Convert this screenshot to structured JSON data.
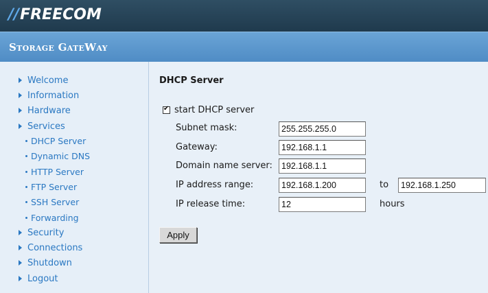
{
  "header": {
    "logo_text": "FREECOM",
    "logo_bars": "//",
    "product_name": "Storage GateWay",
    "colors": {
      "topbar": "#1f3a4d",
      "subbar": "#5a95cc",
      "logo_accent": "#5fa8e8",
      "link": "#2a78c2"
    }
  },
  "sidebar": {
    "items": [
      {
        "label": "Welcome"
      },
      {
        "label": "Information"
      },
      {
        "label": "Hardware"
      },
      {
        "label": "Services"
      }
    ],
    "services_sub": [
      {
        "label": "DHCP Server"
      },
      {
        "label": "Dynamic DNS"
      },
      {
        "label": "HTTP Server"
      },
      {
        "label": "FTP Server"
      },
      {
        "label": "SSH Server"
      },
      {
        "label": "Forwarding"
      }
    ],
    "items_after": [
      {
        "label": "Security"
      },
      {
        "label": "Connections"
      },
      {
        "label": "Shutdown"
      },
      {
        "label": "Logout"
      }
    ]
  },
  "main": {
    "title": "DHCP Server",
    "start_dhcp": {
      "label": "start DHCP server",
      "checked": true
    },
    "fields": {
      "subnet_mask": {
        "label": "Subnet mask:",
        "value": "255.255.255.0"
      },
      "gateway": {
        "label": "Gateway:",
        "value": "192.168.1.1"
      },
      "dns": {
        "label": "Domain name server:",
        "value": "192.168.1.1"
      },
      "ip_range": {
        "label": "IP address range:",
        "from": "192.168.1.200",
        "to_label": "to",
        "to": "192.168.1.250"
      },
      "release_time": {
        "label": "IP release time:",
        "value": "12",
        "unit": "hours"
      }
    },
    "apply_label": "Apply"
  }
}
